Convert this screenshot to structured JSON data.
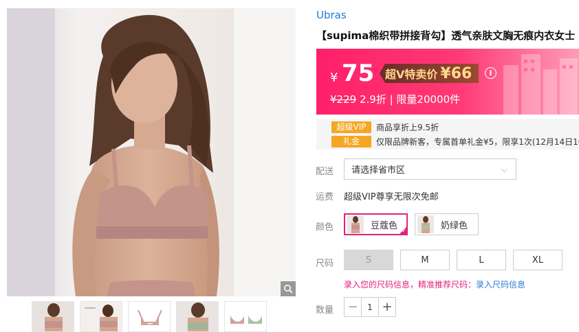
{
  "gallery": {
    "main_image": "model-wearing-bra-photo",
    "zoom_icon": "magnifier-icon",
    "thumbnails": [
      "thumb-1",
      "thumb-2",
      "thumb-3",
      "thumb-4",
      "thumb-5"
    ]
  },
  "product": {
    "brand": "Ubras",
    "title": "【supima棉织带拼接背勾】透气亲肤文胸无痕内衣女士"
  },
  "price": {
    "currency": "¥",
    "value": "75",
    "vip_label": "超V特卖价",
    "vip_price": "¥66",
    "info_glyph": "i",
    "original": "¥229",
    "discount": "2.9折",
    "separator": " | ",
    "limit": "限量20000件"
  },
  "promos": [
    {
      "tag": "超级VIP",
      "text": "商品享折上9.5折"
    },
    {
      "tag": "礼金",
      "text": "仅限品牌新客，专属首单礼金¥5，限享1次(12月14日10"
    }
  ],
  "shipping": {
    "label": "配送",
    "placeholder": "请选择省市区",
    "chevron": "⌵"
  },
  "freight": {
    "label": "运费",
    "text": "超级VIP尊享无限次免邮"
  },
  "colors": {
    "label": "颜色",
    "options": [
      {
        "name": "豆蔻色",
        "selected": true
      },
      {
        "name": "奶绿色",
        "selected": false
      }
    ]
  },
  "sizes": {
    "label": "尺码",
    "options": [
      "S",
      "M",
      "L",
      "XL"
    ],
    "disabled": [
      "S"
    ]
  },
  "size_hint": {
    "text": "录入您的尺码信息，精准推荐尺码：",
    "link": "录入尺码信息"
  },
  "quantity": {
    "label": "数量",
    "minus": "−",
    "value": "1",
    "plus": "+"
  },
  "colors_theme": {
    "accent": "#e4207a",
    "price_gradient_start": "#ff1f6a",
    "link": "#1a7bd6",
    "promo_tag": "#f6a623"
  }
}
